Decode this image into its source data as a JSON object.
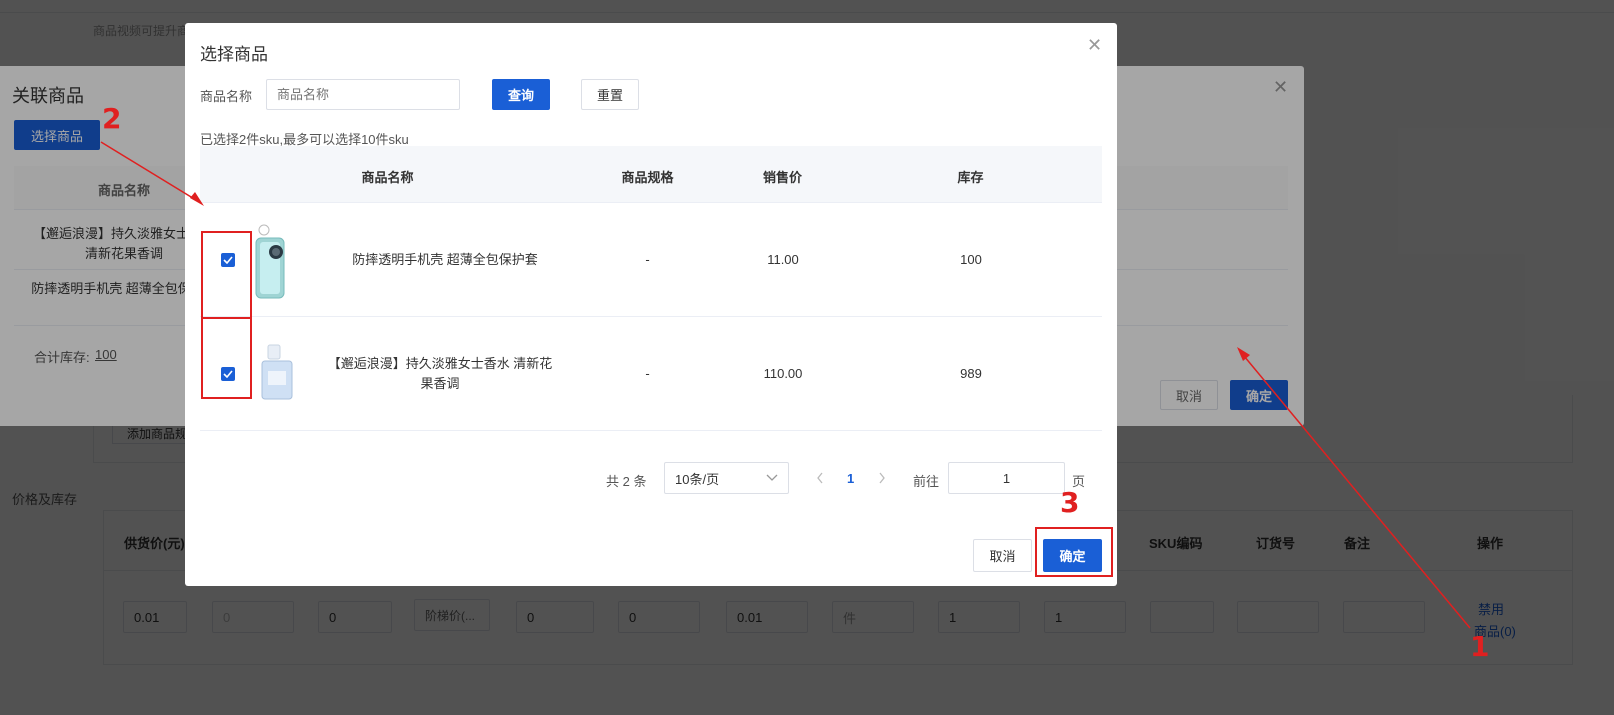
{
  "background_page": {
    "hint_text": "商品视频可提升商",
    "section_add_btn": "添加商品规",
    "price_section_label": "价格及库存",
    "table_headers": [
      "供货价(元)",
      "SKU编码",
      "订货号",
      "备注",
      "操作"
    ],
    "row": {
      "supply_price": "0.01",
      "field2_placeholder": "0",
      "field3": "0",
      "tier_price": "阶梯价(...",
      "field5": "0",
      "field6": "0",
      "field7": "0.01",
      "unit_placeholder": "件",
      "field9": "1",
      "field10": "1"
    },
    "actions": {
      "disable": "禁用",
      "products": "商品(0)"
    }
  },
  "related_dialog": {
    "title": "关联商品",
    "select_btn": "选择商品",
    "col_name": "商品名称",
    "items": [
      "【邂逅浪漫】持久淡雅女士香水 清新花果香调",
      "防摔透明手机壳 超薄全包保护套"
    ],
    "total_stock_label": "合计库存:",
    "total_stock_value": "100",
    "cancel": "取消",
    "confirm": "确定"
  },
  "select_dialog": {
    "title": "选择商品",
    "search": {
      "label": "商品名称",
      "placeholder": "商品名称",
      "query_btn": "查询",
      "reset_btn": "重置"
    },
    "selection_info": "已选择2件sku,最多可以选择10件sku",
    "columns": [
      "商品名称",
      "商品规格",
      "销售价",
      "库存"
    ],
    "rows": [
      {
        "name": "防摔透明手机壳 超薄全包保护套",
        "spec": "-",
        "price": "11.00",
        "stock": "100",
        "checked": true,
        "thumb": "phone-case"
      },
      {
        "name": "【邂逅浪漫】持久淡雅女士香水 清新花果香调",
        "spec": "-",
        "price": "110.00",
        "stock": "989",
        "checked": true,
        "thumb": "perfume"
      }
    ],
    "pagination": {
      "total": "共 2 条",
      "page_size": "10条/页",
      "current_page": "1",
      "goto_label": "前往",
      "goto_value": "1",
      "page_suffix": "页"
    },
    "cancel": "取消",
    "confirm": "确定"
  },
  "annotations": {
    "one": "1",
    "two": "2",
    "three": "3"
  },
  "colors": {
    "primary": "#1a5fd6",
    "annotation": "#e02020",
    "overlay": "rgba(0,0,0,0.5)"
  }
}
